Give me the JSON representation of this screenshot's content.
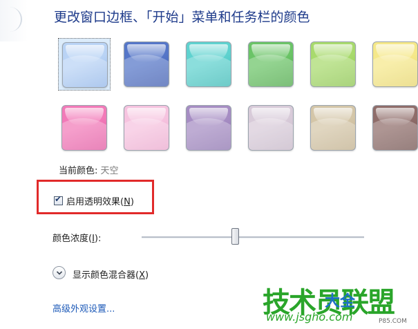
{
  "heading": "更改窗口边框、「开始」菜单和任务栏的颜色",
  "swatches": [
    {
      "name": "sky",
      "color": "#b9d3f5",
      "dark": "#8fb4e8",
      "selected": true
    },
    {
      "name": "twilight",
      "color": "#5576c8",
      "dark": "#3c59ad",
      "selected": false
    },
    {
      "name": "sea",
      "color": "#5fd2cf",
      "dark": "#37b7b3",
      "selected": false
    },
    {
      "name": "leaf",
      "color": "#6bc467",
      "dark": "#4aa645",
      "selected": false
    },
    {
      "name": "lime",
      "color": "#a8da6d",
      "dark": "#89c34b",
      "selected": false
    },
    {
      "name": "sun",
      "color": "#f5e88a",
      "dark": "#e6d46a",
      "selected": false
    },
    {
      "name": "fuchsia",
      "color": "#f27ab8",
      "dark": "#e0559f",
      "selected": false
    },
    {
      "name": "blush",
      "color": "#f6c3df",
      "dark": "#eaa6cc",
      "selected": false
    },
    {
      "name": "violet",
      "color": "#a68dc3",
      "dark": "#8a70ad",
      "selected": false
    },
    {
      "name": "lavender",
      "color": "#d8cbd9",
      "dark": "#c4b5c6",
      "selected": false
    },
    {
      "name": "taupe",
      "color": "#d4c6a8",
      "dark": "#bfad89",
      "selected": false
    },
    {
      "name": "chocolate",
      "color": "#8f6d6a",
      "dark": "#6f4f4c",
      "selected": false
    }
  ],
  "current_color_label": "当前颜色:",
  "current_color_name": "天空",
  "transparency": {
    "checked": true,
    "label_prefix": "启用透明效果(",
    "label_key": "N",
    "label_suffix": ")"
  },
  "intensity": {
    "label_prefix": "颜色浓度(",
    "label_key": "I",
    "label_suffix": "):",
    "value": 0.42
  },
  "mixer": {
    "label_prefix": "显示颜色混合器(",
    "label_key": "X",
    "label_suffix": ")"
  },
  "advanced_link": "高级外观设置...",
  "watermark": {
    "main": "技术员联盟",
    "secondary": "大全",
    "url": "www.jsgho.com",
    "small": "P85.COM"
  }
}
